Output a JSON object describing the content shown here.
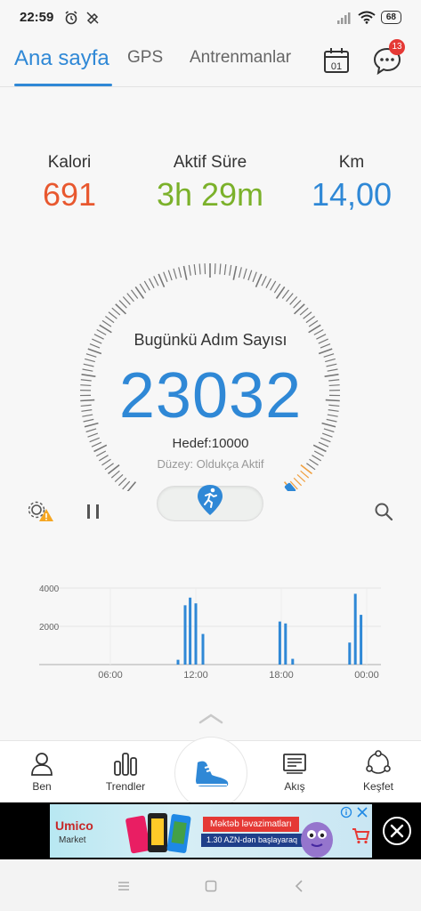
{
  "status_bar": {
    "time": "22:59",
    "battery": "68",
    "icons": [
      "alarm-icon",
      "do-not-disturb-icon",
      "signal-icon",
      "wifi-icon",
      "battery-icon"
    ]
  },
  "top_nav": {
    "tabs": [
      {
        "label": "Ana sayfa",
        "active": true
      },
      {
        "label": "GPS",
        "active": false
      },
      {
        "label": "Antrenmanlar",
        "active": false
      }
    ],
    "calendar_day": "01",
    "messages_badge": "13",
    "accent_color": "#2f88d6"
  },
  "stats": {
    "calories": {
      "label": "Kalori",
      "value": "691",
      "color": "#e8582f"
    },
    "active_time": {
      "label": "Aktif Süre",
      "value": "3h 29m",
      "color": "#7bb12a"
    },
    "distance": {
      "label": "Km",
      "value": "14,00",
      "color": "#2f88d6"
    }
  },
  "dial": {
    "title": "Bugünkü Adım Sayısı",
    "steps": "23032",
    "goal": "Hedef:10000",
    "level": "Düzey: Oldukça Aktif"
  },
  "controls": {
    "settings_warning": "settings-warning-icon",
    "pause": "pause-icon",
    "activity_toggle": "running-pin-icon",
    "search": "search-icon"
  },
  "chart_data": {
    "type": "bar",
    "ylabels": [
      "4000",
      "2000"
    ],
    "xlabels": [
      "06:00",
      "12:00",
      "18:00",
      "00:00"
    ],
    "ylim": [
      0,
      4000
    ],
    "bar_color": "#2f88d6",
    "bars": [
      {
        "hour": 10.75,
        "value": 250
      },
      {
        "hour": 11.25,
        "value": 3100
      },
      {
        "hour": 11.6,
        "value": 3500
      },
      {
        "hour": 12.0,
        "value": 3200
      },
      {
        "hour": 12.5,
        "value": 1600
      },
      {
        "hour": 17.9,
        "value": 2250
      },
      {
        "hour": 18.3,
        "value": 2150
      },
      {
        "hour": 18.8,
        "value": 300
      },
      {
        "hour": 22.8,
        "value": 1150
      },
      {
        "hour": 23.2,
        "value": 3700
      },
      {
        "hour": 23.6,
        "value": 2600
      }
    ]
  },
  "bottom_nav": {
    "items": [
      {
        "label": "Ben",
        "icon": "person-icon"
      },
      {
        "label": "Trendler",
        "icon": "bar-chart-icon"
      },
      {
        "label": "Akış",
        "icon": "feed-icon"
      },
      {
        "label": "Keşfet",
        "icon": "discover-icon"
      }
    ],
    "center_icon": "shoe-icon"
  },
  "ad": {
    "brand": "Umico",
    "brand_sub": "Market",
    "headline": "Məktəb ləvazimatları",
    "subline": "1.30 AZN-dən başlayaraq"
  }
}
